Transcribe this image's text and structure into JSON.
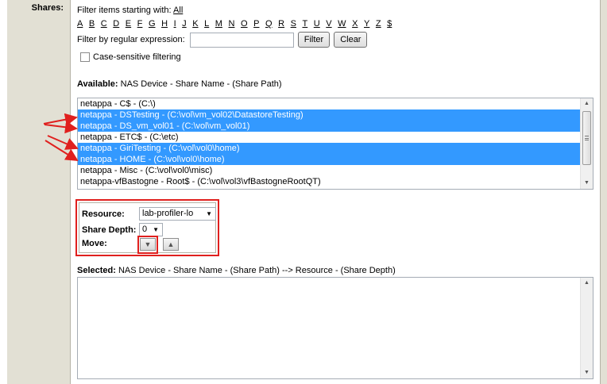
{
  "shares_label": "Shares:",
  "filter": {
    "prefix": "Filter items starting with:",
    "all_label": "All",
    "letters": [
      "A",
      "B",
      "C",
      "D",
      "E",
      "F",
      "G",
      "H",
      "I",
      "J",
      "K",
      "L",
      "M",
      "N",
      "O",
      "P",
      "Q",
      "R",
      "S",
      "T",
      "U",
      "V",
      "W",
      "X",
      "Y",
      "Z",
      "$"
    ]
  },
  "regex": {
    "label": "Filter by regular expression:",
    "value": "",
    "filter_button": "Filter",
    "clear_button": "Clear"
  },
  "case_sensitive": {
    "label": "Case-sensitive filtering",
    "checked": false
  },
  "available": {
    "heading_bold": "Available:",
    "heading_rest": "NAS Device - Share Name - (Share Path)",
    "items": [
      {
        "text": "netappa - C$ - (C:\\)",
        "selected": false
      },
      {
        "text": "netappa - DSTesting - (C:\\vol\\vm_vol02\\DatastoreTesting)",
        "selected": true
      },
      {
        "text": "netappa - DS_vm_vol01 - (C:\\vol\\vm_vol01)",
        "selected": true
      },
      {
        "text": "netappa - ETC$ - (C:\\etc)",
        "selected": false
      },
      {
        "text": "netappa - GiriTesting - (C:\\vol\\vol0\\home)",
        "selected": true
      },
      {
        "text": "netappa - HOME - (C:\\vol\\vol0\\home)",
        "selected": true
      },
      {
        "text": "netappa - Misc - (C:\\vol\\vol0\\misc)",
        "selected": false
      },
      {
        "text": "netappa-vfBastogne - Root$ - (C:\\vol\\vol3\\vfBastogneRootQT)",
        "selected": false
      }
    ]
  },
  "resource_panel": {
    "resource_label": "Resource:",
    "resource_value": "lab-profiler-lo",
    "share_depth_label": "Share Depth:",
    "share_depth_value": "0",
    "move_label": "Move:"
  },
  "selected": {
    "heading_bold": "Selected:",
    "heading_rest": "NAS Device - Share Name - (Share Path) --> Resource - (Share Depth)",
    "items": []
  },
  "colors": {
    "selection": "#3399ff",
    "highlight_red": "#e0201e",
    "sidebar": "#e2e0d4"
  }
}
